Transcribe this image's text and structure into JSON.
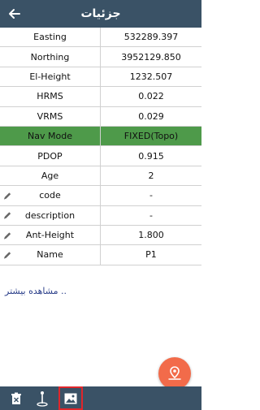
{
  "header": {
    "title": "جزئیات"
  },
  "rows": [
    {
      "label": "Easting",
      "value": "532289.397"
    },
    {
      "label": "Northing",
      "value": "3952129.850"
    },
    {
      "label": "El-Height",
      "value": "1232.507"
    },
    {
      "label": "HRMS",
      "value": "0.022"
    },
    {
      "label": "VRMS",
      "value": "0.029"
    },
    {
      "label": "Nav Mode",
      "value": "FIXED(Topo)"
    },
    {
      "label": "PDOP",
      "value": "0.915"
    },
    {
      "label": "Age",
      "value": "2"
    },
    {
      "label": "code",
      "value": "-"
    },
    {
      "label": "description",
      "value": "-"
    },
    {
      "label": "Ant-Height",
      "value": "1.800"
    },
    {
      "label": "Name",
      "value": "P1"
    }
  ],
  "more_link": "مشاهده بیشتر ..",
  "colors": {
    "header": "#3a5266",
    "nav_mode_row": "#4e9a4a",
    "fab": "#f26b4a",
    "active_outline": "#e0262b"
  }
}
